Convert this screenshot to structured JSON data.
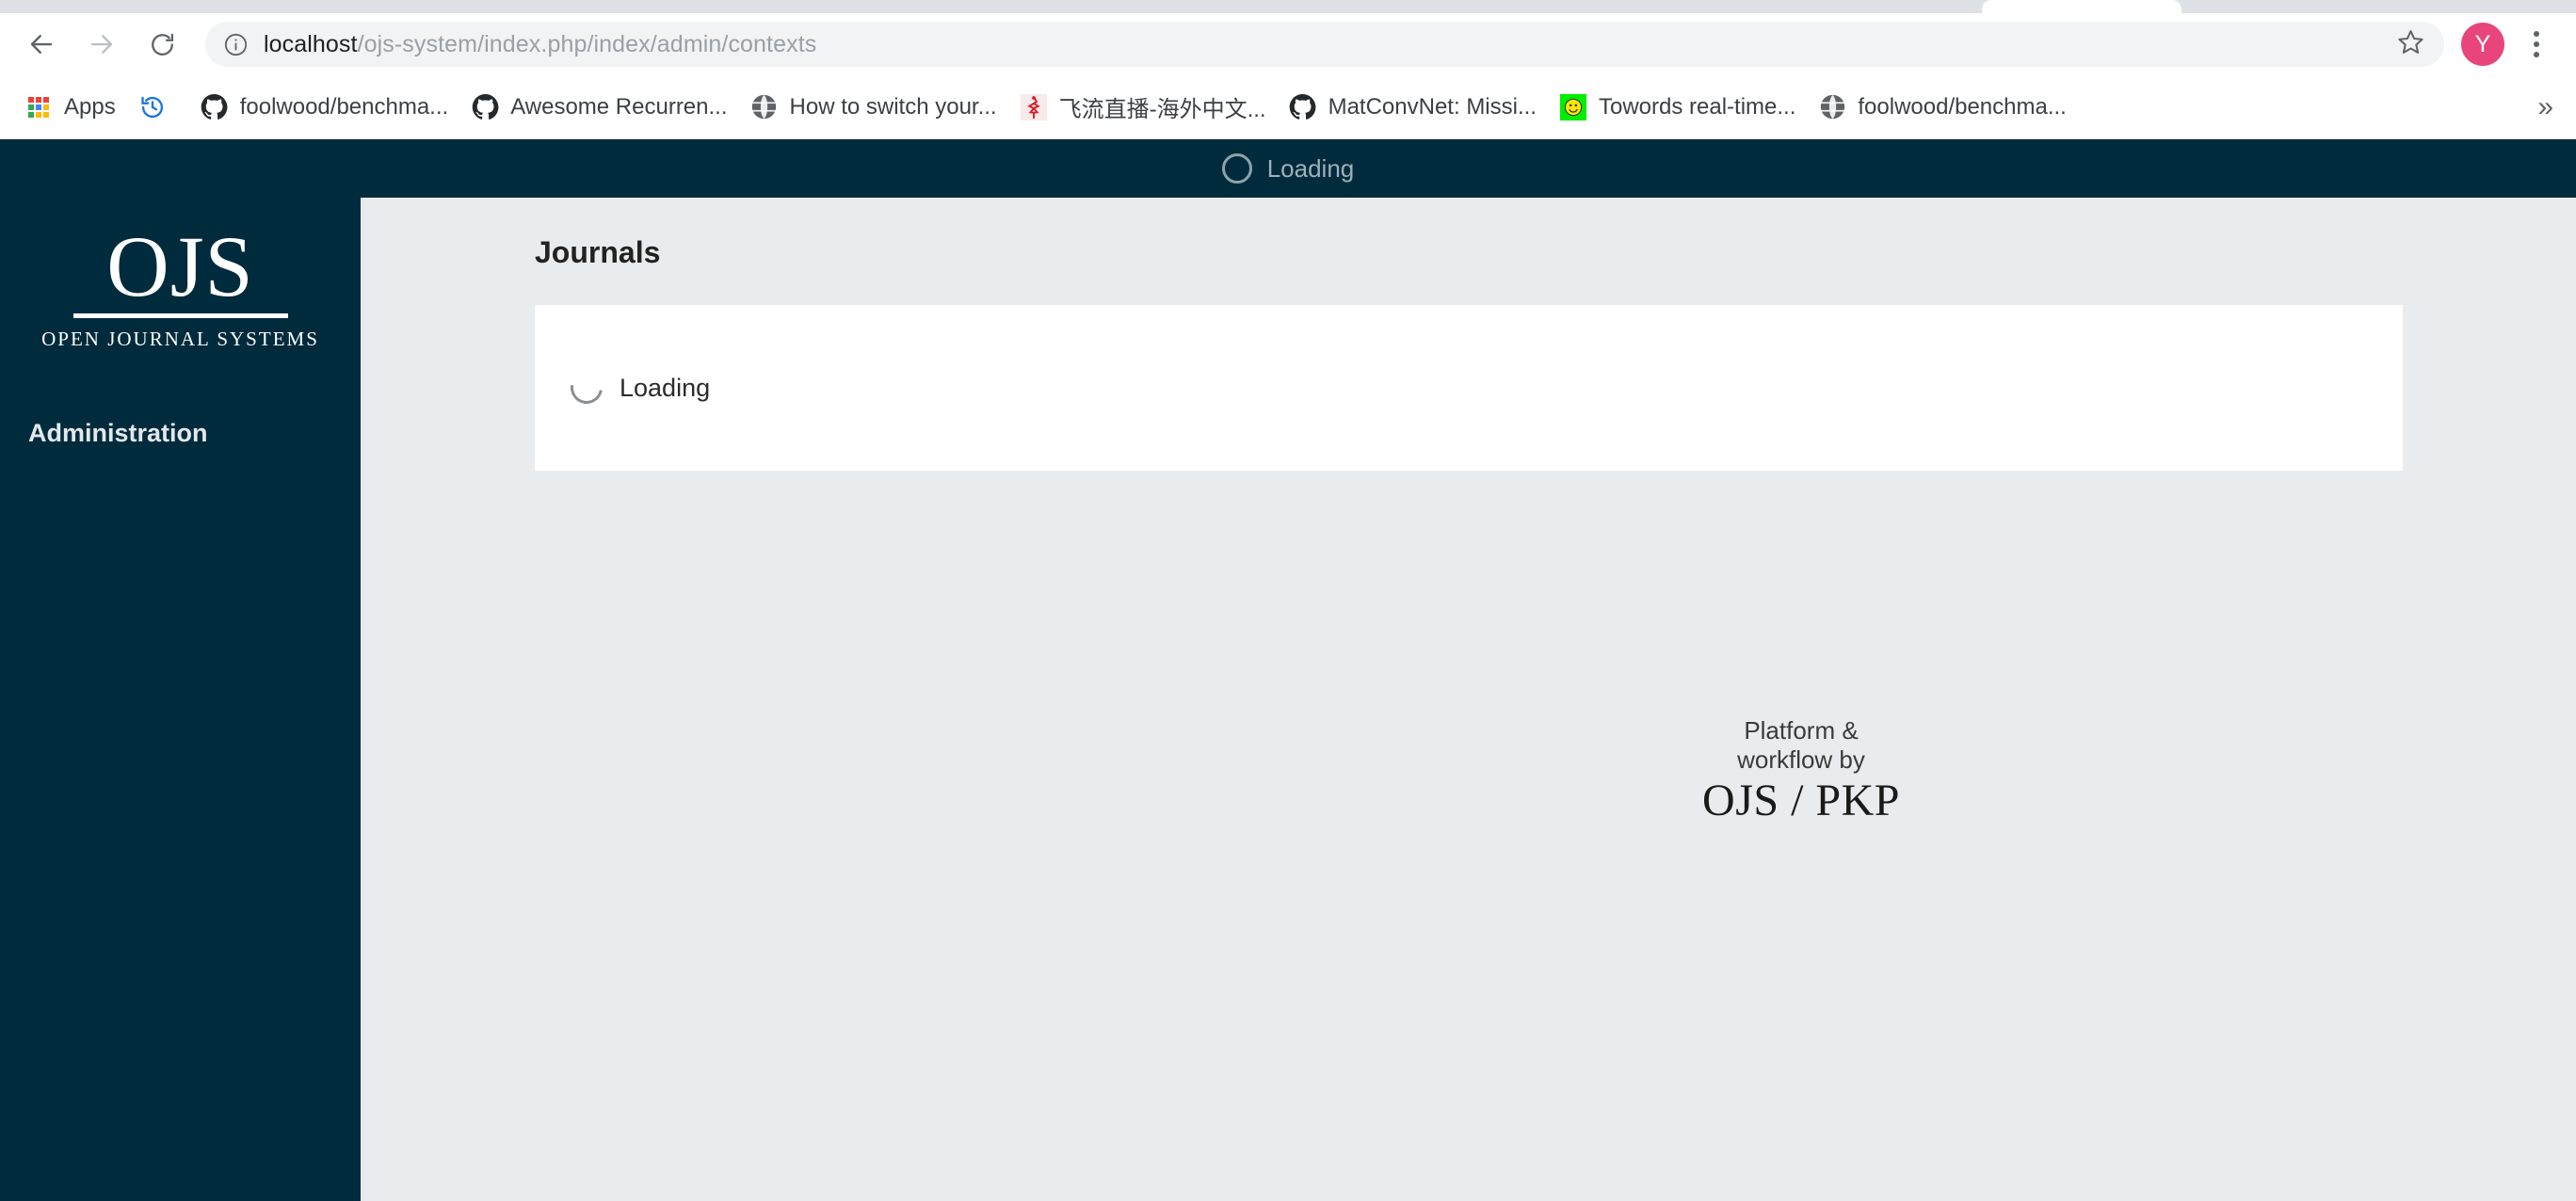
{
  "browser": {
    "url_host": "localhost",
    "url_path": "/ojs-system/index.php/index/admin/contexts",
    "back_icon": "back-arrow-icon",
    "forward_icon": "forward-arrow-icon",
    "reload_icon": "reload-icon",
    "info_icon": "info-circle-icon",
    "star_icon": "star-outline-icon",
    "menu_icon": "three-dot-menu-icon",
    "profile_initial": "Y",
    "profile_color": "#e8457c",
    "bookmarks": [
      {
        "label": "Apps",
        "icon": "apps-grid-icon"
      },
      {
        "label": "",
        "icon": "history-clock-icon"
      },
      {
        "label": "foolwood/benchma...",
        "icon": "github-icon"
      },
      {
        "label": "Awesome Recurren...",
        "icon": "github-icon"
      },
      {
        "label": "How to switch your...",
        "icon": "globe-icon"
      },
      {
        "label": "飞流直播-海外中文...",
        "icon": "red-favicon-icon"
      },
      {
        "label": "MatConvNet: Missi...",
        "icon": "github-icon"
      },
      {
        "label": "Towords real-time...",
        "icon": "green-smiley-icon"
      },
      {
        "label": "foolwood/benchma...",
        "icon": "globe-icon"
      }
    ],
    "overflow_label": "»"
  },
  "ojs": {
    "header": {
      "loading_label": "Loading",
      "spinner_icon": "loading-spinner-icon",
      "bg_color": "#002b3d"
    },
    "sidebar": {
      "logo_main": "OJS",
      "logo_sub": "OPEN JOURNAL SYSTEMS",
      "section_title": "Administration",
      "bg_color": "#002b3d"
    },
    "main": {
      "page_title": "Journals",
      "panel": {
        "loading_label": "Loading",
        "spinner_icon": "loading-spinner-icon"
      }
    },
    "footer": {
      "line1": "Platform &",
      "line2": "workflow by",
      "logo": "OJS / PKP"
    }
  }
}
